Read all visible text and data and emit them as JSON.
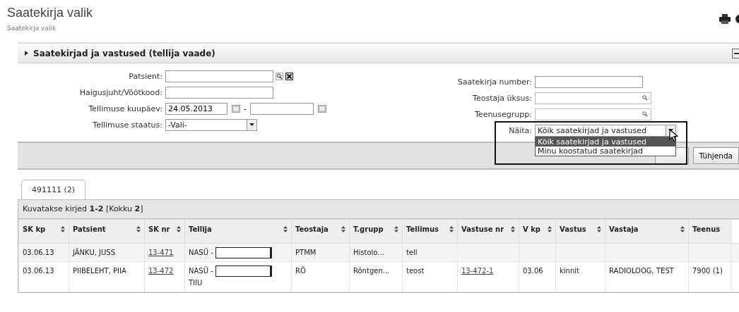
{
  "page": {
    "title": "Saatekirja valik",
    "subtitle": "Saatekirja valik"
  },
  "panel": {
    "title": "Saatekirjad ja vastused (tellija vaade)"
  },
  "form_left": [
    {
      "label": "Patsient:",
      "kind": "lookup_clear"
    },
    {
      "label": "Haigusjuht/Vöötkood:",
      "kind": "text"
    },
    {
      "label": "Tellimuse kuupäev:",
      "kind": "date_range",
      "value": "24.05.2013",
      "separator": "-"
    },
    {
      "label": "Tellimuse staatus:",
      "kind": "select",
      "value": "-Vali-"
    }
  ],
  "form_right": [
    {
      "label": "Saatekirja number:",
      "kind": "text"
    },
    {
      "label": "Teostaja üksus:",
      "kind": "lookup"
    },
    {
      "label": "Teenusegrupp:",
      "kind": "lookup"
    }
  ],
  "show_select": {
    "label": "Näita:",
    "value": "Kõik saatekirjad ja vastused",
    "expanded": true,
    "options": [
      {
        "label": "Kõik saatekirjad ja vastused",
        "selected": true
      },
      {
        "label": "Minu koostatud saatekirjad",
        "selected": false
      }
    ]
  },
  "clear_button": {
    "label": "Tühjenda"
  },
  "tabs": [
    {
      "label": "491111 (2)",
      "selected": true
    }
  ],
  "summary": "Kuvatakse kirjed **1-2** [Kokku **2**]",
  "table": {
    "columns": [
      {
        "label": "SK kp",
        "sortable": true
      },
      {
        "label": "Patsient",
        "sortable": true
      },
      {
        "label": "SK nr",
        "sortable": true
      },
      {
        "label": "Tellija",
        "sortable": true
      },
      {
        "label": "Teostaja",
        "sortable": true
      },
      {
        "label": "T.grupp",
        "sortable": true
      },
      {
        "label": "Tellimus",
        "sortable": true
      },
      {
        "label": "Vastuse nr",
        "sortable": true
      },
      {
        "label": "V kp",
        "sortable": true
      },
      {
        "label": "Vastus",
        "sortable": true
      },
      {
        "label": "Vastaja",
        "sortable": true
      },
      {
        "label": "Teenus",
        "sortable": false
      }
    ],
    "rows": [
      {
        "cells": [
          {
            "kind": "text",
            "text": "03.06.13"
          },
          {
            "kind": "text",
            "text": "JÄNKU, JUSS"
          },
          {
            "kind": "link",
            "text": "13-471"
          },
          {
            "kind": "masked",
            "text": "NASÜ -"
          },
          {
            "kind": "text",
            "text": "PTMM"
          },
          {
            "kind": "text",
            "text": "Histolo..."
          },
          {
            "kind": "text",
            "text": "tell"
          },
          {
            "kind": "text",
            "text": ""
          },
          {
            "kind": "text",
            "text": ""
          },
          {
            "kind": "text",
            "text": ""
          },
          {
            "kind": "text",
            "text": ""
          },
          {
            "kind": "text",
            "text": ""
          }
        ]
      },
      {
        "cells": [
          {
            "kind": "text",
            "text": "03.06.13"
          },
          {
            "kind": "text",
            "text": "PIIBELEHT, PIIA"
          },
          {
            "kind": "link",
            "text": "13-472"
          },
          {
            "kind": "masked",
            "text": "NASÜ -",
            "after": "TIIU"
          },
          {
            "kind": "text",
            "text": "RÖ"
          },
          {
            "kind": "text",
            "text": "Röntgen..."
          },
          {
            "kind": "text",
            "text": "teost"
          },
          {
            "kind": "link",
            "text": "13-472-1"
          },
          {
            "kind": "text",
            "text": "03.06"
          },
          {
            "kind": "text",
            "text": "kinnit"
          },
          {
            "kind": "text",
            "text": "RADIOLOOG, TEST"
          },
          {
            "kind": "text",
            "text": "7900 (1)"
          }
        ]
      }
    ]
  }
}
